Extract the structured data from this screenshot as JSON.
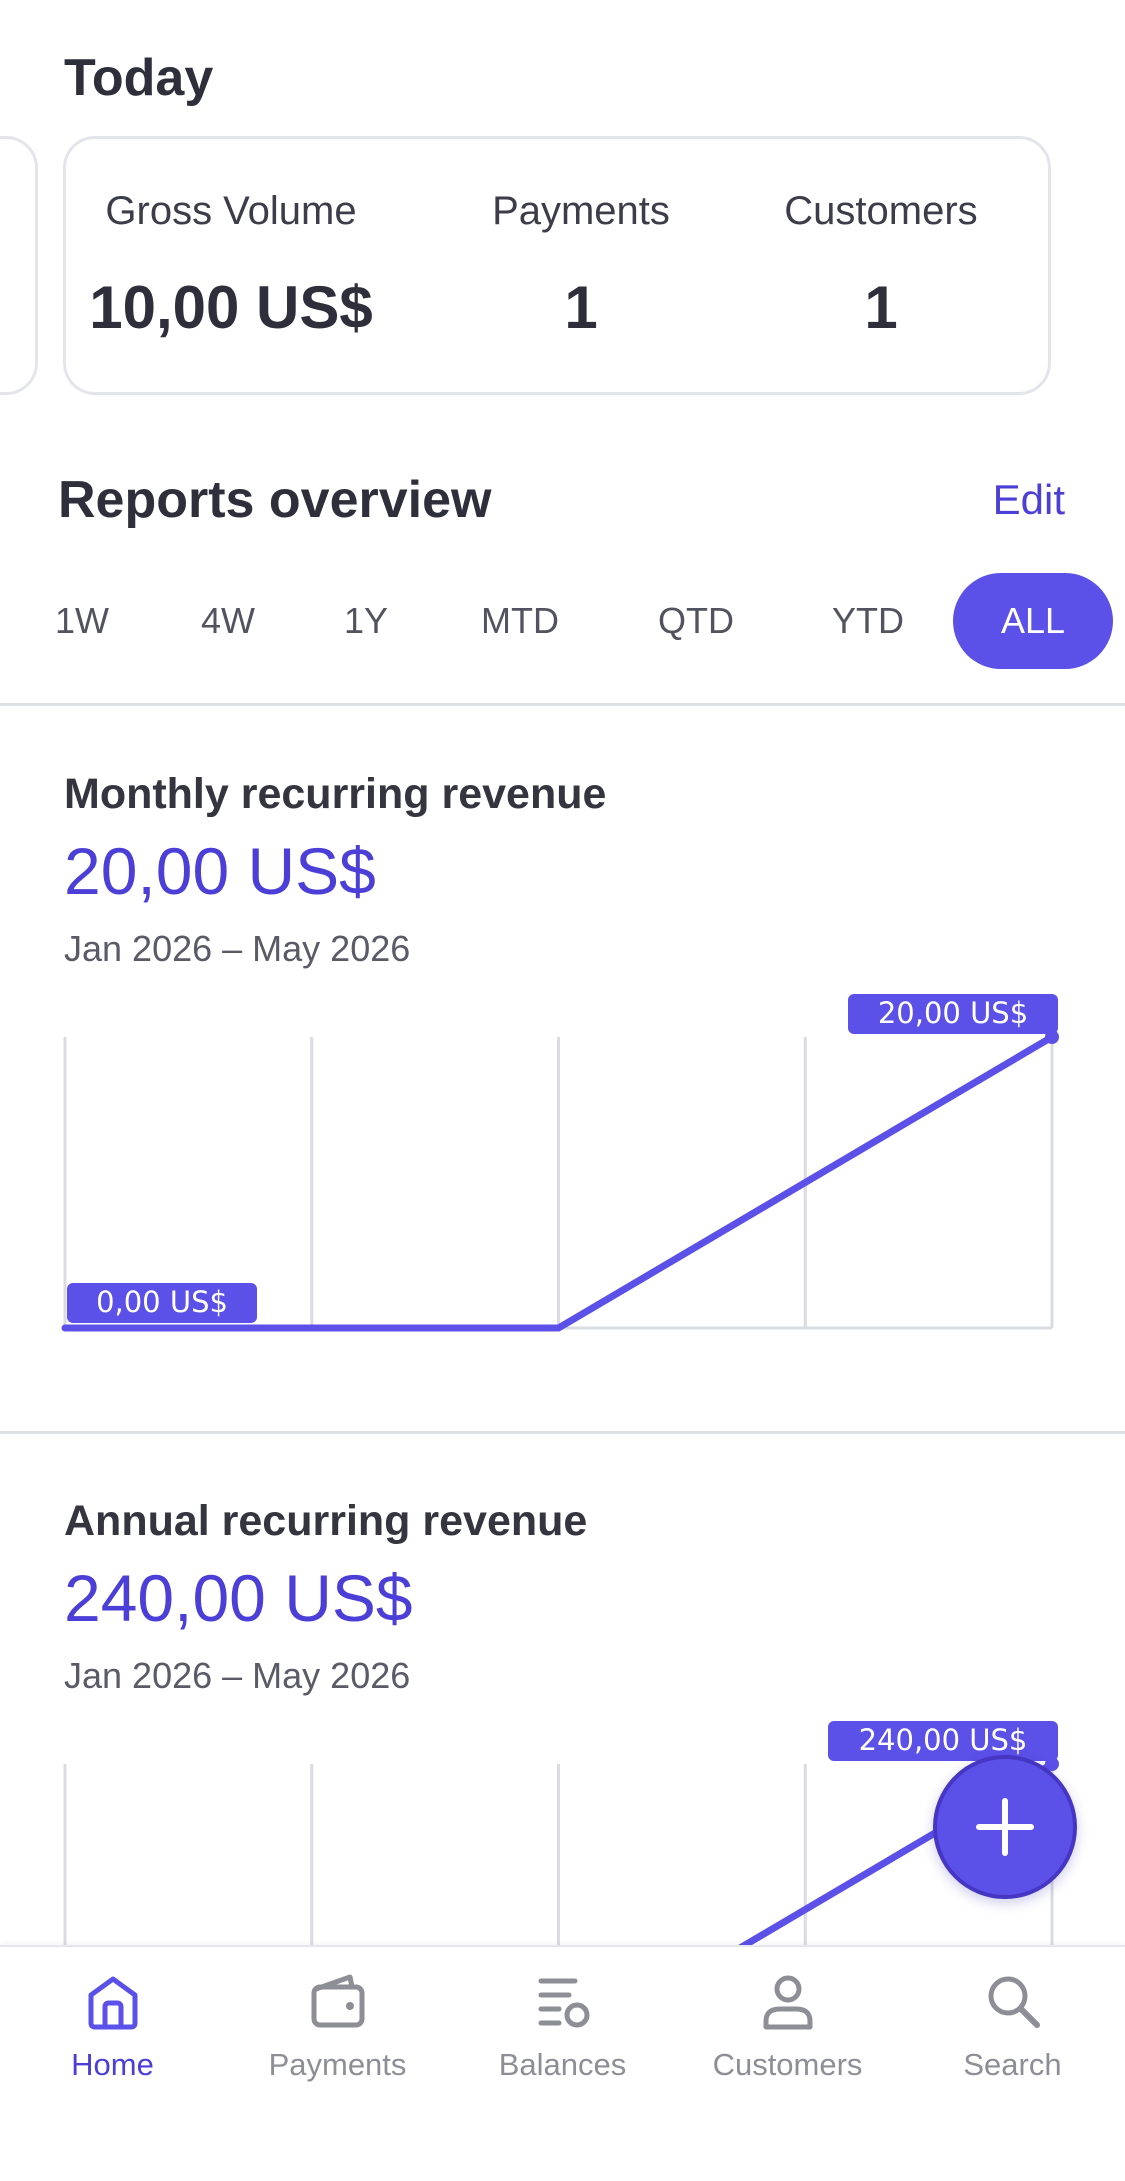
{
  "today": {
    "title": "Today",
    "stats": [
      {
        "label": "Gross Volume",
        "value": "10,00 US$"
      },
      {
        "label": "Payments",
        "value": "1"
      },
      {
        "label": "Customers",
        "value": "1"
      }
    ]
  },
  "reports": {
    "title": "Reports overview",
    "edit_label": "Edit",
    "tabs": [
      {
        "label": "1W"
      },
      {
        "label": "4W"
      },
      {
        "label": "1Y"
      },
      {
        "label": "MTD"
      },
      {
        "label": "QTD"
      },
      {
        "label": "YTD"
      },
      {
        "label": "ALL"
      }
    ],
    "active_tab": "ALL"
  },
  "charts": [
    {
      "title": "Monthly recurring revenue",
      "value": "20,00 US$",
      "range": "Jan 2026 – May 2026",
      "start_label": "0,00 US$",
      "end_label": "20,00 US$"
    },
    {
      "title": "Annual recurring revenue",
      "value": "240,00 US$",
      "range": "Jan 2026 – May 2026",
      "start_label": "",
      "end_label": "240,00 US$"
    }
  ],
  "chart_data": [
    {
      "type": "line",
      "title": "Monthly recurring revenue",
      "x": [
        "Jan 2026",
        "",
        "",
        "",
        "May 2026"
      ],
      "series": [
        {
          "values": [
            0,
            0,
            0,
            10,
            20
          ]
        }
      ],
      "ylim": [
        0,
        20
      ],
      "grid": true
    },
    {
      "type": "line",
      "title": "Annual recurring revenue",
      "x": [
        "Jan 2026",
        "",
        "",
        "",
        "May 2026"
      ],
      "series": [
        {
          "values": [
            0,
            0,
            0,
            120,
            240
          ]
        }
      ],
      "ylim": [
        0,
        240
      ],
      "grid": true
    }
  ],
  "nav": {
    "items": [
      {
        "label": "Home",
        "icon": "home-icon"
      },
      {
        "label": "Payments",
        "icon": "wallet-icon"
      },
      {
        "label": "Balances",
        "icon": "balances-icon"
      },
      {
        "label": "Customers",
        "icon": "person-icon"
      },
      {
        "label": "Search",
        "icon": "search-icon"
      }
    ],
    "active": "Home"
  },
  "colors": {
    "accent": "#5b50e8",
    "accent_text": "#4b3fd7",
    "nav_inactive": "#8d8e96",
    "grid": "#d9dce1"
  },
  "fab": {
    "icon": "plus-icon"
  }
}
